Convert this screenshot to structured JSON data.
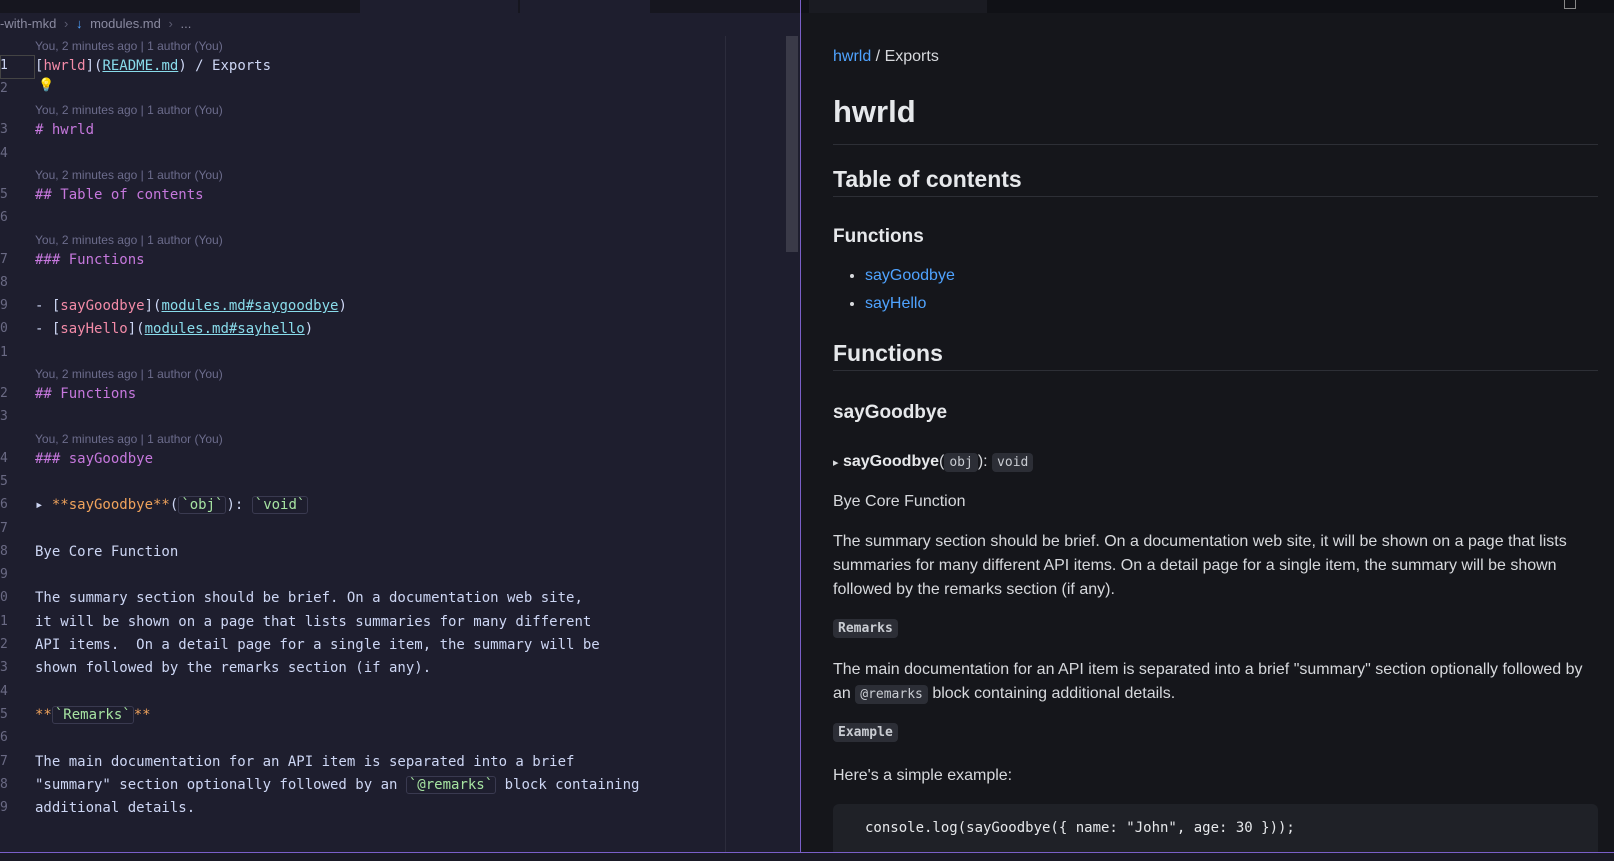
{
  "breadcrumb": {
    "folder": "-with-mkd",
    "file": "modules.md",
    "more": "..."
  },
  "blame_text": "You, 2 minutes ago | 1 author (You)",
  "editor_lines": [
    {
      "n": "1",
      "parts": [
        [
          "br",
          "["
        ],
        [
          "lt",
          "hwrld"
        ],
        [
          "br",
          "]("
        ],
        [
          "lk",
          "README.md"
        ],
        [
          "br",
          ") / Exports"
        ]
      ]
    },
    {
      "n": "2",
      "parts": []
    },
    {
      "n": "3",
      "parts": [
        [
          "hd",
          "# hwrld"
        ]
      ]
    },
    {
      "n": "4",
      "parts": []
    },
    {
      "n": "5",
      "parts": [
        [
          "hd",
          "## Table of contents"
        ]
      ]
    },
    {
      "n": "6",
      "parts": []
    },
    {
      "n": "7",
      "parts": [
        [
          "hd",
          "### Functions"
        ]
      ]
    },
    {
      "n": "8",
      "parts": []
    },
    {
      "n": "9",
      "parts": [
        [
          "br",
          "- ["
        ],
        [
          "lt",
          "sayGoodbye"
        ],
        [
          "br",
          "]("
        ],
        [
          "lk",
          "modules.md#saygoodbye"
        ],
        [
          "br",
          ")"
        ]
      ]
    },
    {
      "n": "0",
      "parts": [
        [
          "br",
          "- ["
        ],
        [
          "lt",
          "sayHello"
        ],
        [
          "br",
          "]("
        ],
        [
          "lk",
          "modules.md#sayhello"
        ],
        [
          "br",
          ")"
        ]
      ]
    },
    {
      "n": "1",
      "parts": []
    },
    {
      "n": "2",
      "parts": [
        [
          "hd",
          "## Functions"
        ]
      ]
    },
    {
      "n": "3",
      "parts": []
    },
    {
      "n": "4",
      "parts": [
        [
          "hd",
          "### sayGoodbye"
        ]
      ]
    },
    {
      "n": "5",
      "parts": []
    },
    {
      "n": "6",
      "parts": [
        [
          "br",
          "▸ "
        ],
        [
          "bd",
          "**sayGoodbye**"
        ],
        [
          "br",
          "("
        ],
        [
          "cd",
          "`obj`"
        ],
        [
          "br",
          "): "
        ],
        [
          "cd",
          "`void`"
        ]
      ]
    },
    {
      "n": "7",
      "parts": []
    },
    {
      "n": "8",
      "parts": [
        [
          "br",
          "Bye Core Function"
        ]
      ]
    },
    {
      "n": "9",
      "parts": []
    },
    {
      "n": "0",
      "parts": [
        [
          "br",
          "The summary section should be brief. On a documentation web site,"
        ]
      ]
    },
    {
      "n": "1",
      "parts": [
        [
          "br",
          "it will be shown on a page that lists summaries for many different"
        ]
      ]
    },
    {
      "n": "2",
      "parts": [
        [
          "br",
          "API items.  On a detail page for a single item, the summary will be"
        ]
      ]
    },
    {
      "n": "3",
      "parts": [
        [
          "br",
          "shown followed by the remarks section (if any)."
        ]
      ]
    },
    {
      "n": "4",
      "parts": []
    },
    {
      "n": "5",
      "parts": [
        [
          "bd",
          "**"
        ],
        [
          "cd",
          "`Remarks`"
        ],
        [
          "bd",
          "**"
        ]
      ]
    },
    {
      "n": "6",
      "parts": []
    },
    {
      "n": "7",
      "parts": [
        [
          "br",
          "The main documentation for an API item is separated into a brief"
        ]
      ]
    },
    {
      "n": "8",
      "parts": [
        [
          "br",
          "\"summary\" section optionally followed by an "
        ],
        [
          "cd",
          "`@remarks`"
        ],
        [
          "br",
          " block containing"
        ]
      ]
    },
    {
      "n": "9",
      "parts": [
        [
          "br",
          "additional details."
        ]
      ]
    }
  ],
  "preview": {
    "crumb_link": "hwrld",
    "crumb_rest": " / Exports",
    "h1": "hwrld",
    "toc_heading": "Table of contents",
    "toc_sub": "Functions",
    "toc_items": [
      "sayGoodbye",
      "sayHello"
    ],
    "functions_heading": "Functions",
    "fn_heading": "sayGoodbye",
    "sig_arrow": "▸",
    "sig_name": "sayGoodbye",
    "sig_open": "(",
    "sig_param": "obj",
    "sig_close": "): ",
    "sig_ret": "void",
    "bye": "Bye Core Function",
    "summary": "The summary section should be brief. On a documentation web site, it will be shown on a page that lists summaries for many different API items. On a detail page for a single item, the summary will be shown followed by the remarks section (if any).",
    "remarks_label": "Remarks",
    "main_doc_a": "The main documentation for an API item is separated into a brief \"summary\" section optionally followed by an ",
    "remarks_code": "@remarks",
    "main_doc_b": " block containing additional details.",
    "example_label": "Example",
    "example_intro": "Here's a simple example:",
    "code_line": "console.log(sayGoodbye({ name: \"John\", age: 30 }));"
  }
}
